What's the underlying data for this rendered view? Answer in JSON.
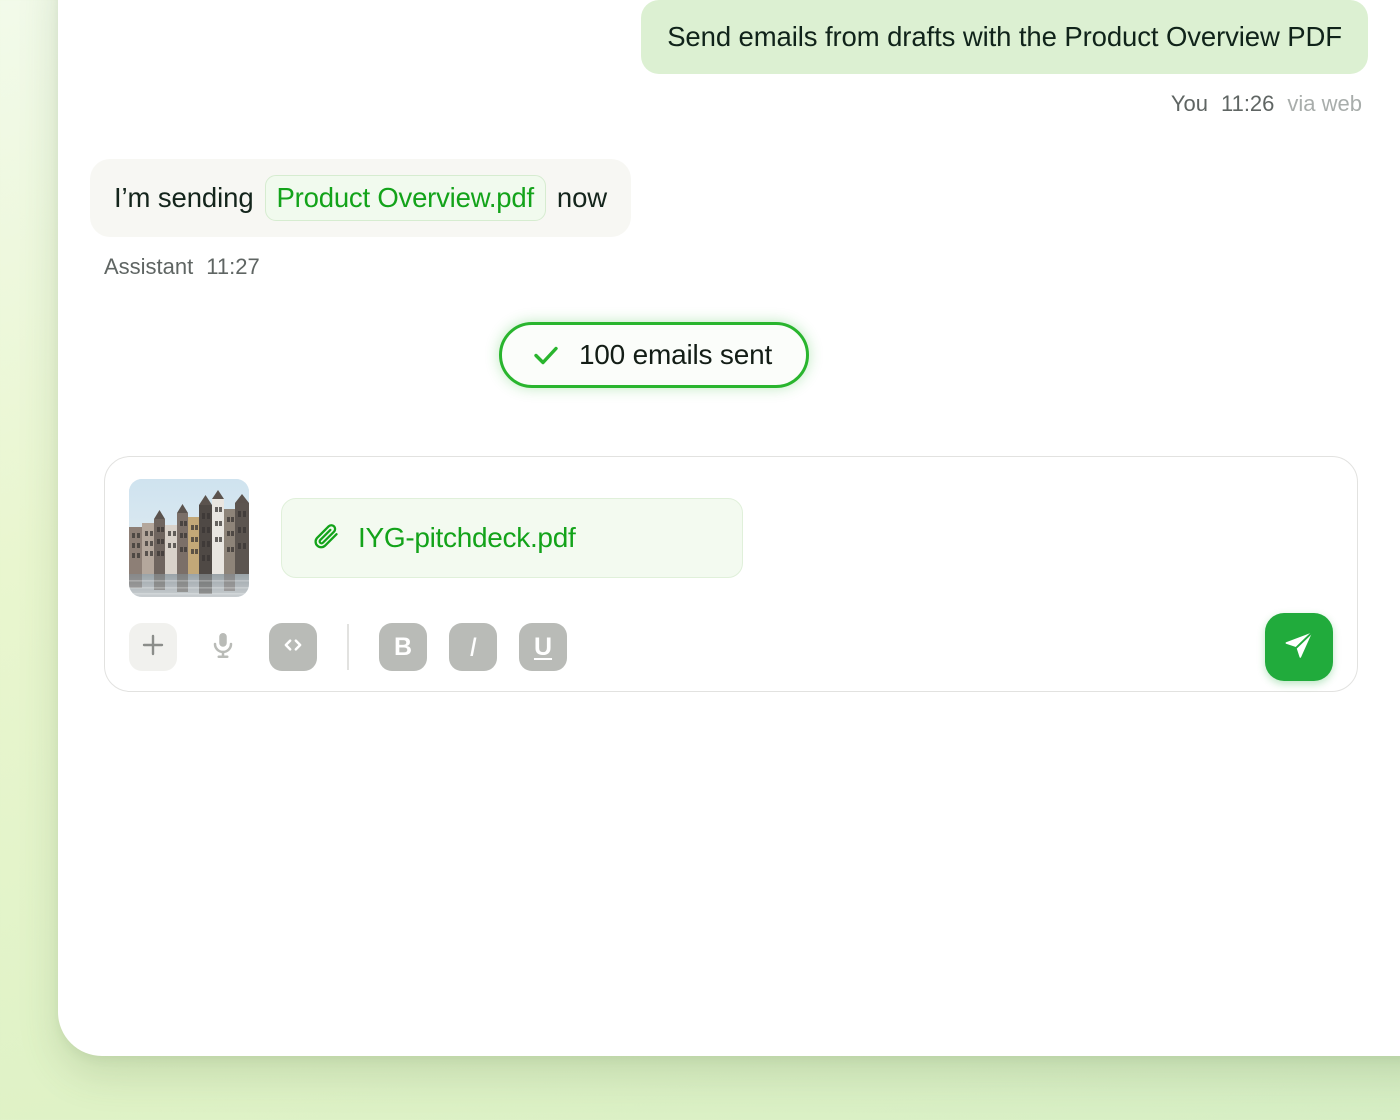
{
  "theme": {
    "accent_green": "#13a31a",
    "send_button_green": "#21ab3c",
    "status_border_green": "#29b52e",
    "user_bubble_green": "#dcf0d2",
    "assistant_bubble": "#f7f7f3",
    "backdrop_gradient_start": "#f2faea",
    "backdrop_gradient_end": "#d6eec4",
    "panel_background": "#ffffff"
  },
  "conversation": {
    "messages": [
      {
        "role": "user",
        "text": "Send emails from drafts with the Product Overview PDF",
        "author": "You",
        "time": "11:26",
        "source": "via web"
      },
      {
        "role": "assistant",
        "text_before": "I’m sending",
        "file_chip": "Product Overview.pdf",
        "text_after": "now",
        "author": "Assistant",
        "time": "11:27"
      }
    ],
    "status": {
      "icon": "check-icon",
      "label": "100 emails sent"
    }
  },
  "composer": {
    "attachment": {
      "thumbnail_alt": "amsterdam-canal-houses-thumbnail",
      "chip_icon": "paperclip-icon",
      "filename": "IYG-pitchdeck.pdf"
    },
    "toolbar": {
      "buttons": [
        {
          "name": "add-attachment-button",
          "icon": "plus-icon",
          "glyph": "+",
          "style": "plus-bg"
        },
        {
          "name": "voice-input-button",
          "icon": "microphone-icon",
          "glyph": "",
          "style": "plain"
        },
        {
          "name": "code-format-button",
          "icon": "code-icon",
          "glyph": "<>",
          "style": "gray-bg"
        },
        {
          "name": "bold-format-button",
          "icon": "bold-icon",
          "glyph": "B",
          "style": "gray-bg"
        },
        {
          "name": "italic-format-button",
          "icon": "italic-icon",
          "glyph": "I",
          "style": "gray-bg"
        },
        {
          "name": "underline-format-button",
          "icon": "underline-icon",
          "glyph": "U",
          "style": "gray-bg"
        }
      ]
    },
    "send_button": {
      "icon": "send-paper-plane-icon",
      "label": "Send"
    }
  }
}
